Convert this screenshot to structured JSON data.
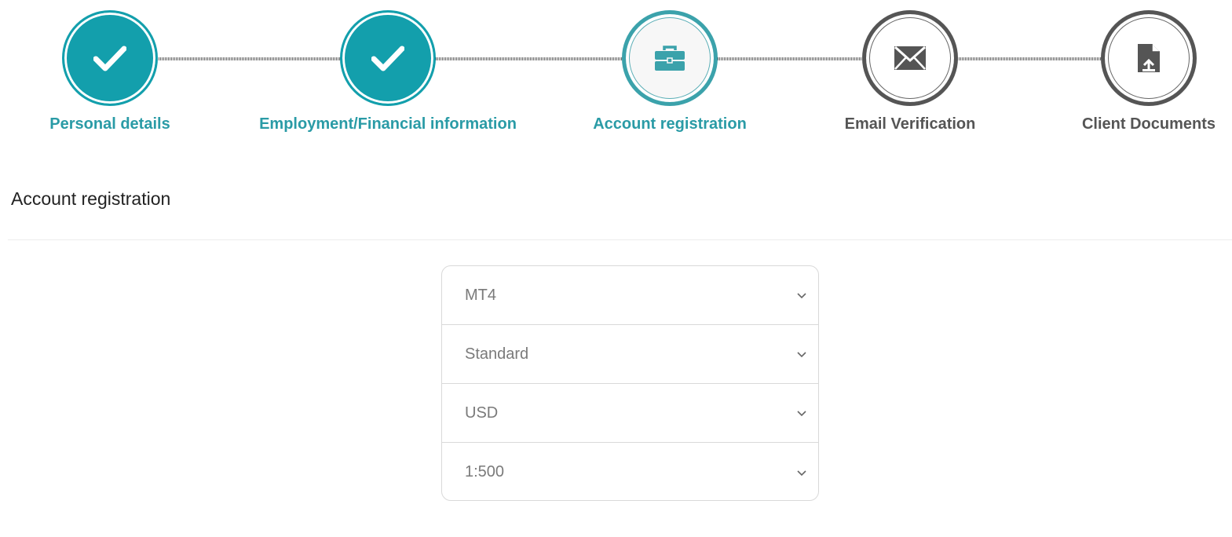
{
  "stepper": {
    "steps": [
      {
        "label": "Personal details",
        "state": "done",
        "icon": "check-icon"
      },
      {
        "label": "Employment/Financial information",
        "state": "done",
        "icon": "check-icon"
      },
      {
        "label": "Account registration",
        "state": "current",
        "icon": "briefcase-icon"
      },
      {
        "label": "Email Verification",
        "state": "pending",
        "icon": "envelope-icon"
      },
      {
        "label": "Client Documents",
        "state": "pending",
        "icon": "document-upload-icon"
      }
    ]
  },
  "section": {
    "title": "Account registration"
  },
  "form": {
    "platform": {
      "value": "MT4"
    },
    "account_type": {
      "value": "Standard"
    },
    "currency": {
      "value": "USD"
    },
    "leverage": {
      "value": "1:500"
    }
  },
  "colors": {
    "accent": "#139fac",
    "label_teal": "#2a9ba6",
    "pending_dark": "#555555"
  }
}
